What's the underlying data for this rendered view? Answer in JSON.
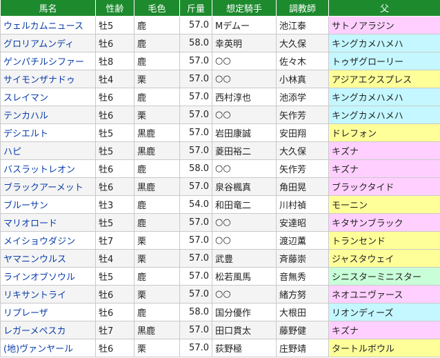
{
  "columns": [
    "馬名",
    "性齢",
    "毛色",
    "斤量",
    "想定騎手",
    "調教師",
    "父"
  ],
  "sire_colors": {
    "pink": "#ffd0ff",
    "cyan": "#c4f7ff",
    "yellow": "#ffff99",
    "green": "#c8ffd8"
  },
  "rows": [
    {
      "horse": "ウェルカムニュース",
      "sex_age": "牡5",
      "coat": "鹿",
      "weight": "57.0",
      "jockey": "Mデムー",
      "trainer": "池江泰",
      "sire": "サトノアラジン",
      "sire_color": "pink"
    },
    {
      "horse": "グロリアムンディ",
      "sex_age": "牡6",
      "coat": "鹿",
      "weight": "58.0",
      "jockey": "幸英明",
      "trainer": "大久保",
      "sire": "キングカメハメハ",
      "sire_color": "cyan"
    },
    {
      "horse": "ゲンパチルシファー",
      "sex_age": "牡8",
      "coat": "鹿",
      "weight": "57.0",
      "jockey": "○○",
      "trainer": "佐々木",
      "sire": "トゥザグローリー",
      "sire_color": "cyan"
    },
    {
      "horse": "サイモンザナドゥ",
      "sex_age": "牡4",
      "coat": "栗",
      "weight": "57.0",
      "jockey": "○○",
      "trainer": "小林真",
      "sire": "アジアエクスプレス",
      "sire_color": "yellow"
    },
    {
      "horse": "スレイマン",
      "sex_age": "牡6",
      "coat": "鹿",
      "weight": "57.0",
      "jockey": "西村淳也",
      "trainer": "池添学",
      "sire": "キングカメハメハ",
      "sire_color": "cyan"
    },
    {
      "horse": "テンカハル",
      "sex_age": "牡6",
      "coat": "栗",
      "weight": "57.0",
      "jockey": "○○",
      "trainer": "矢作芳",
      "sire": "キングカメハメハ",
      "sire_color": "cyan"
    },
    {
      "horse": "デシエルト",
      "sex_age": "牡5",
      "coat": "黒鹿",
      "weight": "57.0",
      "jockey": "岩田康誠",
      "trainer": "安田翔",
      "sire": "ドレフォン",
      "sire_color": "yellow"
    },
    {
      "horse": "ハピ",
      "sex_age": "牡5",
      "coat": "黒鹿",
      "weight": "57.0",
      "jockey": "菱田裕二",
      "trainer": "大久保",
      "sire": "キズナ",
      "sire_color": "pink"
    },
    {
      "horse": "バスラットレオン",
      "sex_age": "牡6",
      "coat": "鹿",
      "weight": "58.0",
      "jockey": "○○",
      "trainer": "矢作芳",
      "sire": "キズナ",
      "sire_color": "pink"
    },
    {
      "horse": "ブラックアーメット",
      "sex_age": "牡6",
      "coat": "黒鹿",
      "weight": "57.0",
      "jockey": "泉谷楓真",
      "trainer": "角田晃",
      "sire": "ブラックタイド",
      "sire_color": "pink"
    },
    {
      "horse": "ブルーサン",
      "sex_age": "牡3",
      "coat": "鹿",
      "weight": "54.0",
      "jockey": "和田竜二",
      "trainer": "川村禎",
      "sire": "モーニン",
      "sire_color": "yellow"
    },
    {
      "horse": "マリオロード",
      "sex_age": "牡5",
      "coat": "鹿",
      "weight": "57.0",
      "jockey": "○○",
      "trainer": "安達昭",
      "sire": "キタサンブラック",
      "sire_color": "pink"
    },
    {
      "horse": "メイショウダジン",
      "sex_age": "牡7",
      "coat": "栗",
      "weight": "57.0",
      "jockey": "○○",
      "trainer": "渡辺薫",
      "sire": "トランセンド",
      "sire_color": "yellow"
    },
    {
      "horse": "ヤマニンウルス",
      "sex_age": "牡4",
      "coat": "栗",
      "weight": "57.0",
      "jockey": "武豊",
      "trainer": "斉藤崇",
      "sire": "ジャスタウェイ",
      "sire_color": "yellow"
    },
    {
      "horse": "ラインオブソウル",
      "sex_age": "牡5",
      "coat": "鹿",
      "weight": "57.0",
      "jockey": "松若風馬",
      "trainer": "音無秀",
      "sire": "シニスターミニスター",
      "sire_color": "green"
    },
    {
      "horse": "リキサントライ",
      "sex_age": "牡6",
      "coat": "栗",
      "weight": "57.0",
      "jockey": "○○",
      "trainer": "緒方努",
      "sire": "ネオユニヴァース",
      "sire_color": "pink"
    },
    {
      "horse": "リプレーザ",
      "sex_age": "牡6",
      "coat": "鹿",
      "weight": "58.0",
      "jockey": "国分優作",
      "trainer": "大根田",
      "sire": "リオンディーズ",
      "sire_color": "cyan"
    },
    {
      "horse": "レガーメペスカ",
      "sex_age": "牡7",
      "coat": "黒鹿",
      "weight": "57.0",
      "jockey": "田口貫太",
      "trainer": "藤野健",
      "sire": "キズナ",
      "sire_color": "pink"
    },
    {
      "horse": "(地)ヴァンヤール",
      "sex_age": "牡6",
      "coat": "栗",
      "weight": "57.0",
      "jockey": "荻野極",
      "trainer": "庄野靖",
      "sire": "タートルボウル",
      "sire_color": "yellow"
    }
  ]
}
